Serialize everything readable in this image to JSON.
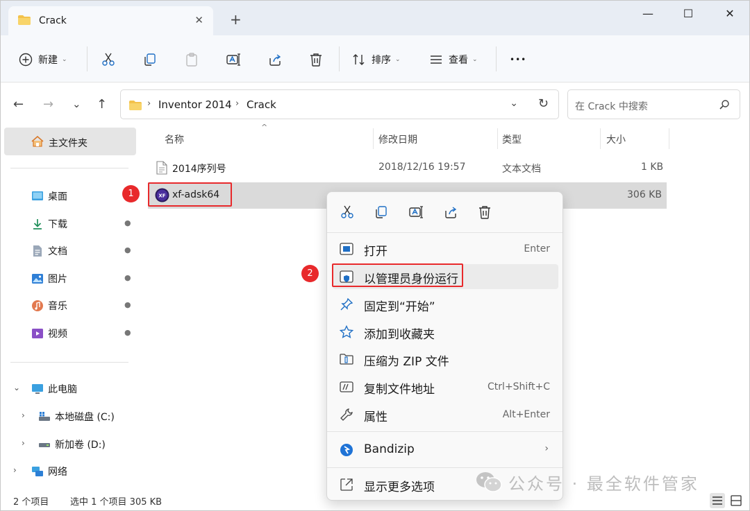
{
  "window": {
    "tab_title": "Crack",
    "tab_close_glyph": "✕",
    "new_tab_glyph": "+",
    "minimize_glyph": "—",
    "maximize_glyph": "☐",
    "close_glyph": "✕"
  },
  "toolbar": {
    "new_label": "新建",
    "sort_label": "排序",
    "view_label": "查看",
    "more_glyph": "•••",
    "caret": "⌄"
  },
  "nav": {
    "back_glyph": "←",
    "forward_glyph": "→",
    "recent_glyph": "⌄",
    "up_glyph": "↑"
  },
  "address": {
    "crumbs": [
      "Inventor 2014",
      "Crack"
    ],
    "sep": "›",
    "chevron": "⌄",
    "refresh": "↻"
  },
  "search": {
    "placeholder": "在 Crack 中搜索"
  },
  "sidebar": {
    "home_label": "主文件夹",
    "quick": [
      {
        "label": "桌面",
        "icon": "desktop-icon"
      },
      {
        "label": "下载",
        "icon": "download-icon"
      },
      {
        "label": "文档",
        "icon": "document-icon"
      },
      {
        "label": "图片",
        "icon": "pictures-icon"
      },
      {
        "label": "音乐",
        "icon": "music-icon"
      },
      {
        "label": "视频",
        "icon": "video-icon"
      }
    ],
    "pin_glyph": "📌",
    "this_pc": "此电脑",
    "drive_c": "本地磁盘 (C:)",
    "drive_d": "新加卷 (D:)",
    "network": "网络",
    "expand_glyph": "›",
    "collapse_glyph": "⌄"
  },
  "columns": {
    "name": "名称",
    "modified": "修改日期",
    "type": "类型",
    "size": "大小",
    "sort_glyph": "^"
  },
  "files": [
    {
      "name": "2014序列号",
      "modified": "2018/12/16 19:57",
      "type": "文本文档",
      "size": "1 KB"
    },
    {
      "name": "xf-adsk64",
      "modified": "",
      "type": "",
      "size": "306 KB"
    }
  ],
  "annotations": {
    "step1": "1",
    "step2": "2"
  },
  "context_menu": {
    "items": [
      {
        "label": "打开",
        "shortcut": "Enter"
      },
      {
        "label": "以管理员身份运行",
        "shortcut": ""
      },
      {
        "label": "固定到“开始”",
        "shortcut": ""
      },
      {
        "label": "添加到收藏夹",
        "shortcut": ""
      },
      {
        "label": "压缩为 ZIP 文件",
        "shortcut": ""
      },
      {
        "label": "复制文件地址",
        "shortcut": "Ctrl+Shift+C"
      },
      {
        "label": "属性",
        "shortcut": "Alt+Enter"
      },
      {
        "label": "Bandizip",
        "shortcut": ""
      },
      {
        "label": "显示更多选项",
        "shortcut": ""
      }
    ],
    "submenu_arrow": "›"
  },
  "status": {
    "item_count": "2 个项目",
    "selection": "选中 1 个项目  305 KB"
  },
  "watermark": {
    "text": "公众号 · 最全软件管家"
  },
  "colors": {
    "accent": "#0067c0",
    "annotation_red": "#e8292b",
    "selection_bg": "#dadada"
  }
}
